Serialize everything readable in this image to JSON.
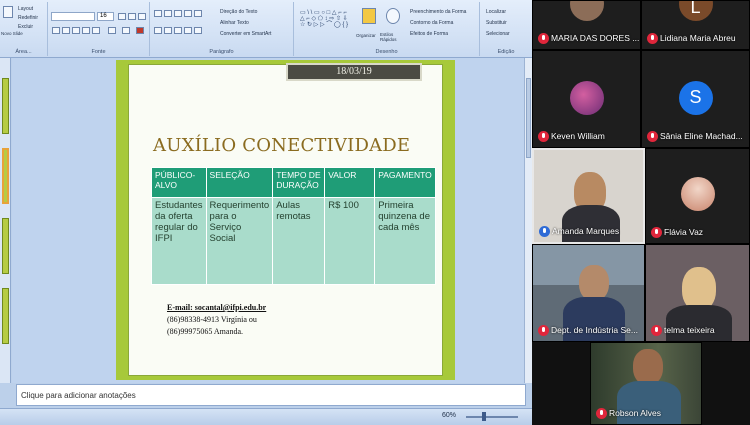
{
  "ribbon": {
    "groups": [
      {
        "label": "Área..."
      },
      {
        "label": "Fonte"
      },
      {
        "label": "Parágrafo"
      },
      {
        "label": "Desenho"
      },
      {
        "label": "Edição"
      }
    ],
    "clipboard": {
      "cut": "Layout",
      "reset": "Redefinir",
      "delete": "Excluir",
      "new_slide": "Novo Slide"
    },
    "font_size": "16",
    "paragraph": {
      "text_direction": "Direção do Texto",
      "align_text": "Alinhar Texto",
      "smartart": "Converter em SmartArt"
    },
    "drawing": {
      "arrange": "Organizar",
      "quick_styles": "Estilos Rápidos",
      "shape_fill": "Preenchimento da Forma",
      "shape_outline": "Contorno da Forma",
      "shape_effects": "Efeitos de Forma"
    },
    "editing": {
      "find": "Localizar",
      "replace": "Substituir",
      "select": "Selecionar"
    }
  },
  "slide": {
    "date": "18/03/19",
    "title": "AUXÍLIO CONECTIVIDADE",
    "table": {
      "headers": [
        "PÚBLICO-ALVO",
        "SELEÇÃO",
        "TEMPO DE DURAÇÃO",
        "VALOR",
        "PAGAMENTO"
      ],
      "row": [
        "Estudantes da oferta regular do IFPI",
        "Requerimento para o Serviço Social",
        "Aulas remotas",
        "R$ 100",
        "Primeira quinzena de cada mês"
      ]
    },
    "contact": {
      "email": "E-mail: socantal@ifpi.edu.br",
      "phone1": "(86)98338-4913 Virgínia ou",
      "phone2": "(86)99975065 Amanda."
    }
  },
  "notes": {
    "placeholder": "Clique para adicionar anotações"
  },
  "status": {
    "zoom": "60%"
  },
  "participants": [
    {
      "name": "MARIA DAS DORES ...",
      "muted": true
    },
    {
      "name": "Lidiana Maria Abreu",
      "muted": true,
      "initial": "L"
    },
    {
      "name": "Keven William",
      "muted": true
    },
    {
      "name": "Sânia Eline Machad...",
      "muted": true,
      "initial": "S"
    },
    {
      "name": "Amanda Marques",
      "muted": false
    },
    {
      "name": "Flávia Vaz",
      "muted": true
    },
    {
      "name": "Dept. de Indústria Se...",
      "muted": true
    },
    {
      "name": "telma teixeira",
      "muted": true
    },
    {
      "name": "Robson Alves",
      "muted": true
    }
  ],
  "colors": {
    "slide_green": "#a7c93a",
    "table_header": "#1f9d77",
    "table_cell": "#a9dccb",
    "title_gold": "#8a6b1f",
    "mic_muted": "#e0263b",
    "avatar_lidiana": "#7a4a2a",
    "avatar_sania": "#1b73e8"
  }
}
